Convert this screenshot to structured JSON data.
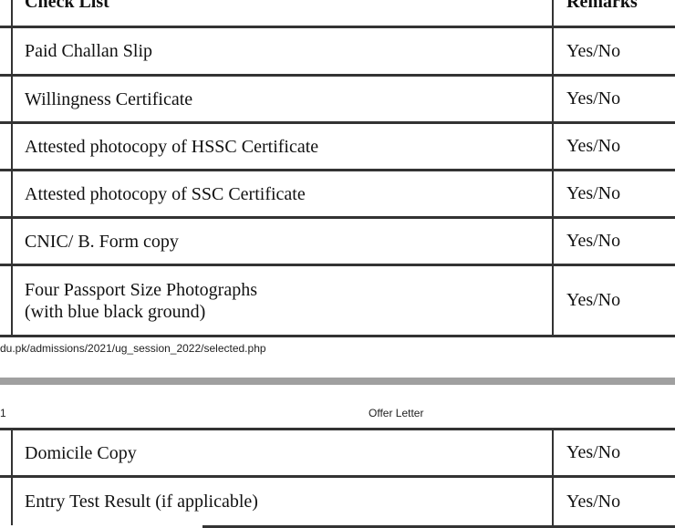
{
  "table_header": {
    "check_list": "Check List",
    "remarks": "Remarks"
  },
  "rows_page1": [
    {
      "item": "Paid Challan Slip",
      "remark": "Yes/No"
    },
    {
      "item": "Willingness Certificate",
      "remark": "Yes/No"
    },
    {
      "item": "Attested photocopy of HSSC Certificate",
      "remark": "Yes/No"
    },
    {
      "item": "Attested photocopy of SSC Certificate",
      "remark": "Yes/No"
    },
    {
      "item": "CNIC/ B. Form copy",
      "remark": "Yes/No"
    },
    {
      "item_line1": "Four Passport Size Photographs",
      "item_line2": "(with blue black ground)",
      "remark": "Yes/No"
    }
  ],
  "footer_url": "du.pk/admissions/2021/ug_session_2022/selected.php",
  "print_header": {
    "page_num": "1",
    "doc_title": "Offer Letter"
  },
  "rows_page2": [
    {
      "item": "Domicile Copy",
      "remark": "Yes/No"
    },
    {
      "item": "Entry Test Result (if applicable)",
      "remark": "Yes/No"
    }
  ]
}
